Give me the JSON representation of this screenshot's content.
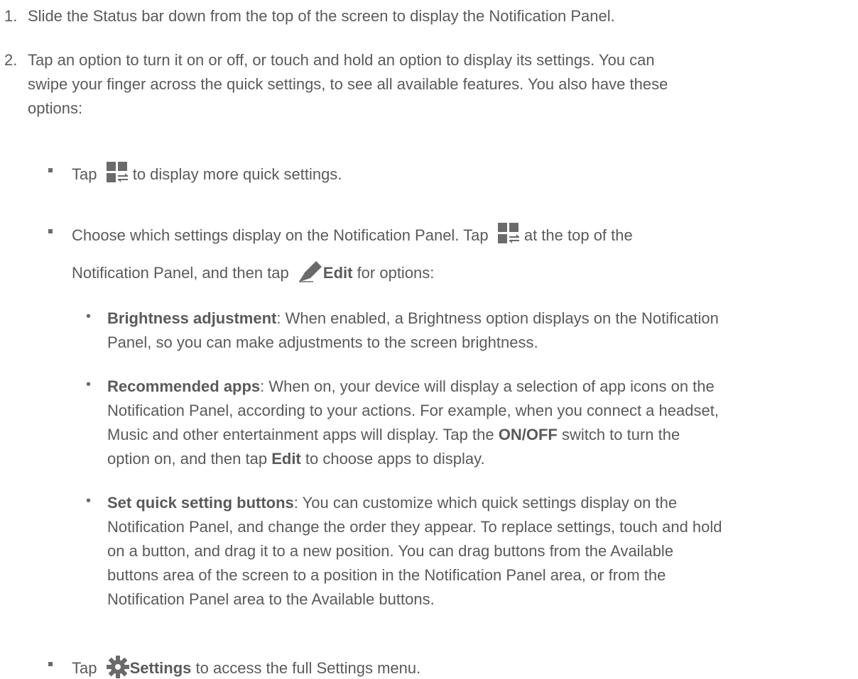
{
  "steps": [
    {
      "number": "1.",
      "text": "Slide the Status bar down from the top of the screen to display the Notification Panel."
    },
    {
      "number": "2.",
      "lines": [
        "Tap an option to turn it on or off, or touch and hold  an option to display its settings. You can",
        "swipe your finger across the quick settings, to see all available features. You also have these",
        "options:"
      ]
    }
  ],
  "options": {
    "opt1": {
      "pre": "Tap",
      "icon": "quick-settings-icon",
      "post": " to display more quick settings."
    },
    "opt2": {
      "line1_pre": "Choose which settings display on the Notification Panel. Tap",
      "icon": "quick-settings-icon",
      "line1_post": " at the top of the",
      "line2_pre": "Notification Panel, and then tap",
      "edit_icon": "pencil-icon",
      "edit_label": "Edit",
      "line2_post": " for options:"
    },
    "opt3": {
      "pre": "Tap",
      "icon": "gear-icon",
      "label": "Settings",
      "post": " to access the full Settings menu."
    }
  },
  "sub_options": [
    {
      "title": "Brightness adjustment",
      "lines": [
        ": When enabled, a Brightness option displays on the Notification",
        "Panel, so you can make adjustments to the screen brightness."
      ]
    },
    {
      "title": "Recommended apps",
      "lines": [
        ": When on, your device will display a selection of app icons on the",
        "Notification Panel, according to your actions. For example, when you connect a headset,",
        "Music and other entertainment apps will display. Tap the ",
        "option on, and then tap "
      ],
      "onoff": "ON/OFF",
      "onoff_post": " switch to turn the",
      "edit": "Edit",
      "edit_post": " to choose apps to display."
    },
    {
      "title": "Set quick setting buttons",
      "lines": [
        ": You can customize which quick settings display on the",
        "Notification Panel, and change the order they appear. To replace settings, touch and hold",
        "on a button, and drag it to a new position. You can drag buttons from the Available",
        "buttons area of the screen to a position in the Notification Panel area, or from the",
        "Notification Panel area to the Available buttons."
      ]
    }
  ],
  "colors": {
    "text": "#5a5a5a",
    "icon": "#6a6a6a"
  }
}
